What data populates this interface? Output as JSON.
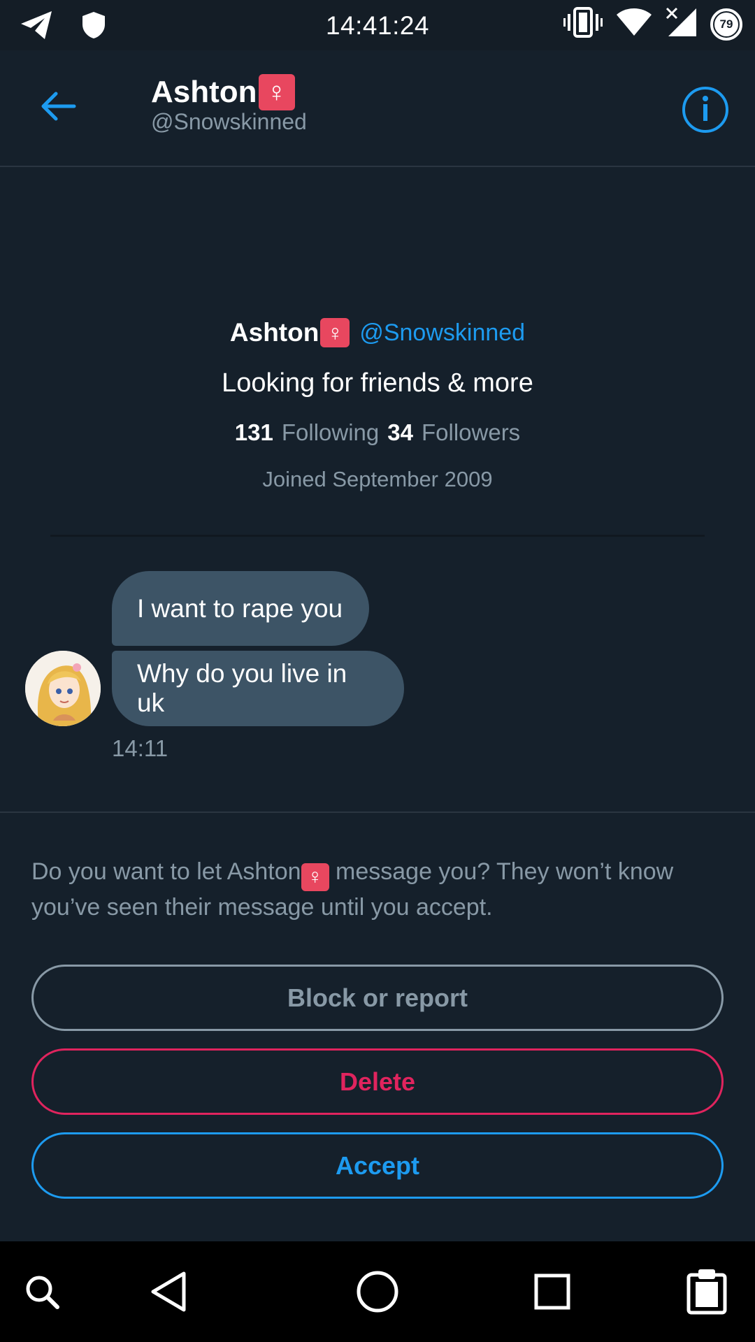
{
  "status_bar": {
    "time": "14:41:24",
    "battery_level": "79",
    "icons": [
      "telegram-icon",
      "shield-icon",
      "vibrate-icon",
      "wifi-icon",
      "no-signal-icon",
      "battery-icon"
    ]
  },
  "header": {
    "name": "Ashton",
    "badge": "♀",
    "handle": "@Snowskinned",
    "back_icon": "arrow-left-icon",
    "info_icon": "info-icon"
  },
  "profile": {
    "name": "Ashton",
    "badge": "♀",
    "handle": "@Snowskinned",
    "bio": "Looking for friends & more",
    "following_count": "131",
    "following_label": "Following",
    "followers_count": "34",
    "followers_label": "Followers",
    "joined": "Joined September 2009"
  },
  "messages": [
    {
      "text": "I want to rape you"
    },
    {
      "text": "Why do you live in uk"
    }
  ],
  "message_time": "14:11",
  "request_prompt": {
    "before": "Do you want to let Ashton",
    "badge": "♀",
    "after": " message you? They won’t know you’ve seen their message until you accept."
  },
  "actions": {
    "block_label": "Block or report",
    "delete_label": "Delete",
    "accept_label": "Accept"
  },
  "colors": {
    "background": "#15202b",
    "accent": "#1d9bf0",
    "danger": "#e0245e",
    "muted": "#8899a6",
    "bubble": "#3d5466"
  },
  "nav_bar": {
    "icons": [
      "search-icon",
      "back-triangle-icon",
      "home-circle-icon",
      "recents-square-icon",
      "clipboard-icon"
    ]
  }
}
